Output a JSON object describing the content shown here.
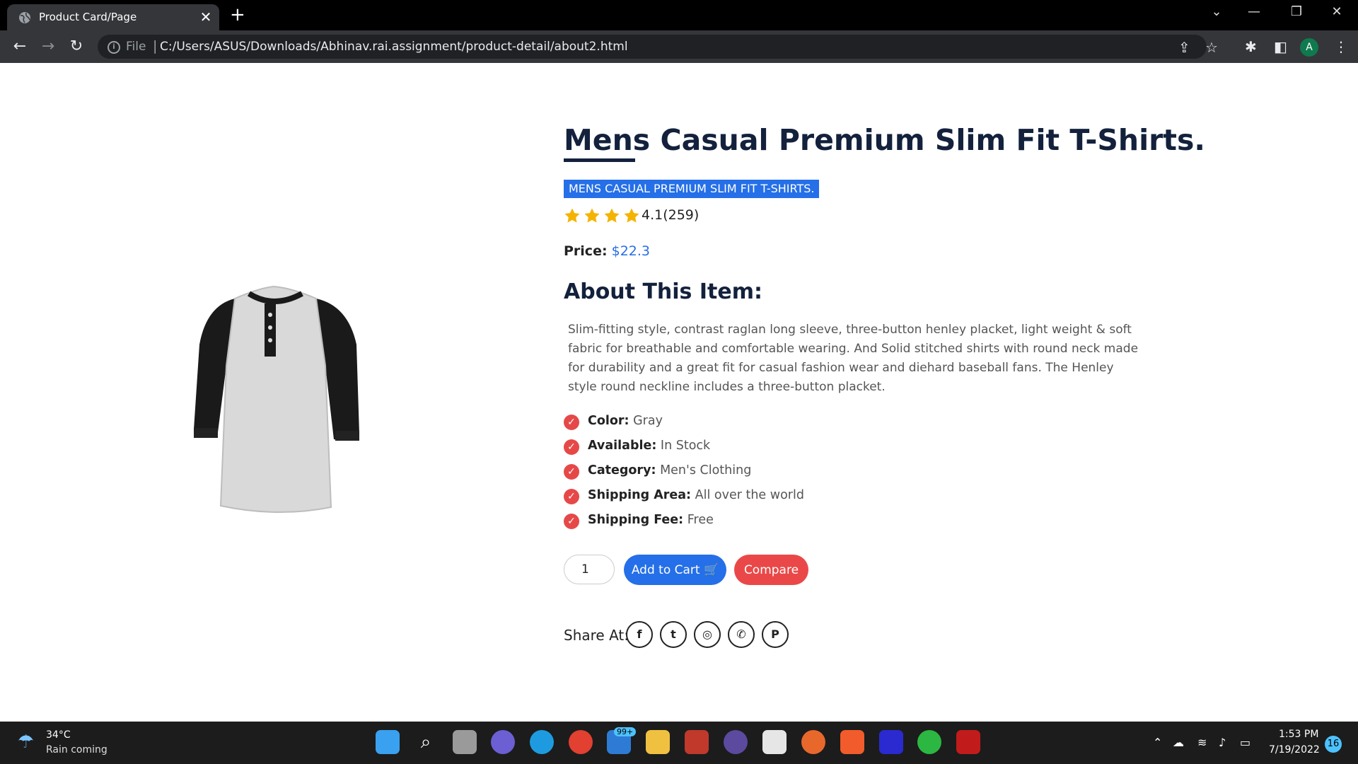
{
  "browser": {
    "tab_title": "Product Card/Page",
    "tab_close": "✕",
    "new_tab": "+",
    "file_label": "File",
    "url_separator": "|",
    "url": "C:/Users/ASUS/Downloads/Abhinav.rai.assignment/product-detail/about2.html",
    "avatar_letter": "A"
  },
  "product": {
    "title": "Mens Casual Premium Slim Fit T-Shirts.",
    "subtitle": "MENS CASUAL PREMIUM SLIM FIT T-SHIRTS.",
    "rating_text": "4.1(259)",
    "star_count": 4,
    "price_label": "Price:",
    "price_value": "$22.3",
    "about_heading": "About This Item:",
    "description": "Slim-fitting style, contrast raglan long sleeve, three-button henley placket, light weight & soft fabric for breathable and comfortable wearing. And Solid stitched shirts with round neck made for durability and a great fit for casual fashion wear and diehard baseball fans. The Henley style round neckline includes a three-button placket.",
    "specs": [
      {
        "label": "Color:",
        "value": "Gray"
      },
      {
        "label": "Available:",
        "value": "In Stock"
      },
      {
        "label": "Category:",
        "value": "Men's Clothing"
      },
      {
        "label": "Shipping Area:",
        "value": "All over the world"
      },
      {
        "label": "Shipping Fee:",
        "value": "Free"
      }
    ],
    "quantity": "1",
    "add_to_cart_label": "Add to Cart",
    "compare_label": "Compare",
    "share_label": "Share At:",
    "share_buttons": [
      "f",
      "t",
      "◎",
      "✆",
      "P"
    ]
  },
  "colors": {
    "accent_blue": "#256fe8",
    "accent_red": "#ea4848",
    "heading_navy": "#13213c",
    "star_gold": "#f5b301"
  },
  "taskbar": {
    "temperature": "34°C",
    "weather": "Rain coming",
    "mail_badge": "99+",
    "time": "1:53 PM",
    "date": "7/19/2022",
    "notifications": "16"
  }
}
